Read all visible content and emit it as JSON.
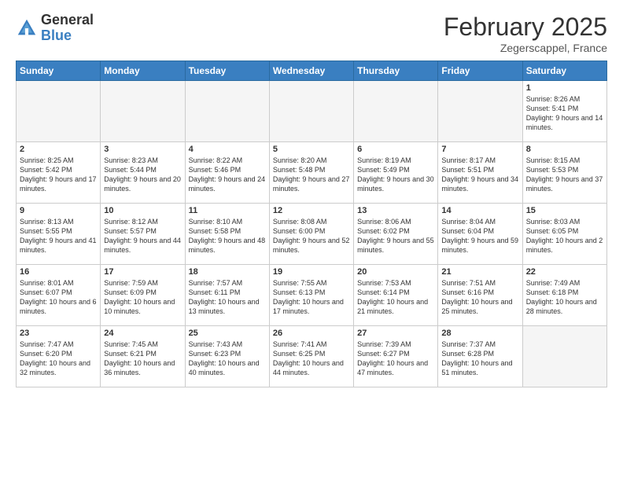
{
  "logo": {
    "general": "General",
    "blue": "Blue"
  },
  "title": "February 2025",
  "location": "Zegerscappel, France",
  "days_header": [
    "Sunday",
    "Monday",
    "Tuesday",
    "Wednesday",
    "Thursday",
    "Friday",
    "Saturday"
  ],
  "weeks": [
    [
      {
        "day": "",
        "info": ""
      },
      {
        "day": "",
        "info": ""
      },
      {
        "day": "",
        "info": ""
      },
      {
        "day": "",
        "info": ""
      },
      {
        "day": "",
        "info": ""
      },
      {
        "day": "",
        "info": ""
      },
      {
        "day": "1",
        "info": "Sunrise: 8:26 AM\nSunset: 5:41 PM\nDaylight: 9 hours and 14 minutes."
      }
    ],
    [
      {
        "day": "2",
        "info": "Sunrise: 8:25 AM\nSunset: 5:42 PM\nDaylight: 9 hours and 17 minutes."
      },
      {
        "day": "3",
        "info": "Sunrise: 8:23 AM\nSunset: 5:44 PM\nDaylight: 9 hours and 20 minutes."
      },
      {
        "day": "4",
        "info": "Sunrise: 8:22 AM\nSunset: 5:46 PM\nDaylight: 9 hours and 24 minutes."
      },
      {
        "day": "5",
        "info": "Sunrise: 8:20 AM\nSunset: 5:48 PM\nDaylight: 9 hours and 27 minutes."
      },
      {
        "day": "6",
        "info": "Sunrise: 8:19 AM\nSunset: 5:49 PM\nDaylight: 9 hours and 30 minutes."
      },
      {
        "day": "7",
        "info": "Sunrise: 8:17 AM\nSunset: 5:51 PM\nDaylight: 9 hours and 34 minutes."
      },
      {
        "day": "8",
        "info": "Sunrise: 8:15 AM\nSunset: 5:53 PM\nDaylight: 9 hours and 37 minutes."
      }
    ],
    [
      {
        "day": "9",
        "info": "Sunrise: 8:13 AM\nSunset: 5:55 PM\nDaylight: 9 hours and 41 minutes."
      },
      {
        "day": "10",
        "info": "Sunrise: 8:12 AM\nSunset: 5:57 PM\nDaylight: 9 hours and 44 minutes."
      },
      {
        "day": "11",
        "info": "Sunrise: 8:10 AM\nSunset: 5:58 PM\nDaylight: 9 hours and 48 minutes."
      },
      {
        "day": "12",
        "info": "Sunrise: 8:08 AM\nSunset: 6:00 PM\nDaylight: 9 hours and 52 minutes."
      },
      {
        "day": "13",
        "info": "Sunrise: 8:06 AM\nSunset: 6:02 PM\nDaylight: 9 hours and 55 minutes."
      },
      {
        "day": "14",
        "info": "Sunrise: 8:04 AM\nSunset: 6:04 PM\nDaylight: 9 hours and 59 minutes."
      },
      {
        "day": "15",
        "info": "Sunrise: 8:03 AM\nSunset: 6:05 PM\nDaylight: 10 hours and 2 minutes."
      }
    ],
    [
      {
        "day": "16",
        "info": "Sunrise: 8:01 AM\nSunset: 6:07 PM\nDaylight: 10 hours and 6 minutes."
      },
      {
        "day": "17",
        "info": "Sunrise: 7:59 AM\nSunset: 6:09 PM\nDaylight: 10 hours and 10 minutes."
      },
      {
        "day": "18",
        "info": "Sunrise: 7:57 AM\nSunset: 6:11 PM\nDaylight: 10 hours and 13 minutes."
      },
      {
        "day": "19",
        "info": "Sunrise: 7:55 AM\nSunset: 6:13 PM\nDaylight: 10 hours and 17 minutes."
      },
      {
        "day": "20",
        "info": "Sunrise: 7:53 AM\nSunset: 6:14 PM\nDaylight: 10 hours and 21 minutes."
      },
      {
        "day": "21",
        "info": "Sunrise: 7:51 AM\nSunset: 6:16 PM\nDaylight: 10 hours and 25 minutes."
      },
      {
        "day": "22",
        "info": "Sunrise: 7:49 AM\nSunset: 6:18 PM\nDaylight: 10 hours and 28 minutes."
      }
    ],
    [
      {
        "day": "23",
        "info": "Sunrise: 7:47 AM\nSunset: 6:20 PM\nDaylight: 10 hours and 32 minutes."
      },
      {
        "day": "24",
        "info": "Sunrise: 7:45 AM\nSunset: 6:21 PM\nDaylight: 10 hours and 36 minutes."
      },
      {
        "day": "25",
        "info": "Sunrise: 7:43 AM\nSunset: 6:23 PM\nDaylight: 10 hours and 40 minutes."
      },
      {
        "day": "26",
        "info": "Sunrise: 7:41 AM\nSunset: 6:25 PM\nDaylight: 10 hours and 44 minutes."
      },
      {
        "day": "27",
        "info": "Sunrise: 7:39 AM\nSunset: 6:27 PM\nDaylight: 10 hours and 47 minutes."
      },
      {
        "day": "28",
        "info": "Sunrise: 7:37 AM\nSunset: 6:28 PM\nDaylight: 10 hours and 51 minutes."
      },
      {
        "day": "",
        "info": ""
      }
    ]
  ]
}
